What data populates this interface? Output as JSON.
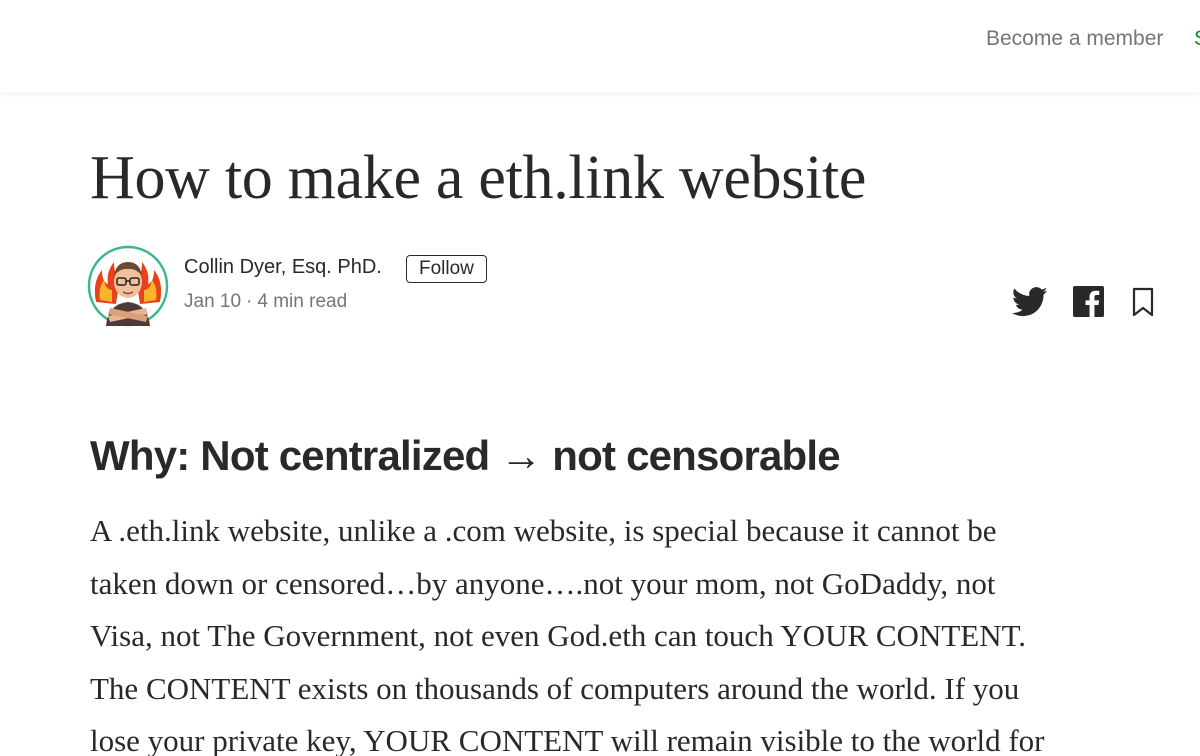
{
  "nav": {
    "become_member": "Become a member",
    "sign_in_partial": "S"
  },
  "article": {
    "title": "How to make a eth.link website",
    "author": {
      "name": "Collin Dyer, Esq. PhD.",
      "follow_label": "Follow",
      "date": "Jan 10",
      "separator": "·",
      "read_time": "4 min read"
    },
    "share_icons": [
      "twitter-icon",
      "facebook-icon",
      "bookmark-icon"
    ],
    "section_heading": "Why: Not centralized → not censorable",
    "paragraph_lines": [
      "A .eth.link website, unlike a .com website, is special because it cannot be",
      "taken down or censored…by anyone….not your mom, not GoDaddy, not",
      "Visa, not The Government, not even God.eth can touch YOUR CONTENT.",
      "The CONTENT exists on thousands of computers around the world. If you",
      "lose your private key, YOUR CONTENT will remain visible to the world for"
    ]
  },
  "colors": {
    "text": "#292929",
    "muted": "#757575",
    "accent_green": "#1a8917",
    "avatar_ring": "#3fb58a",
    "flame": "#e8421c"
  }
}
